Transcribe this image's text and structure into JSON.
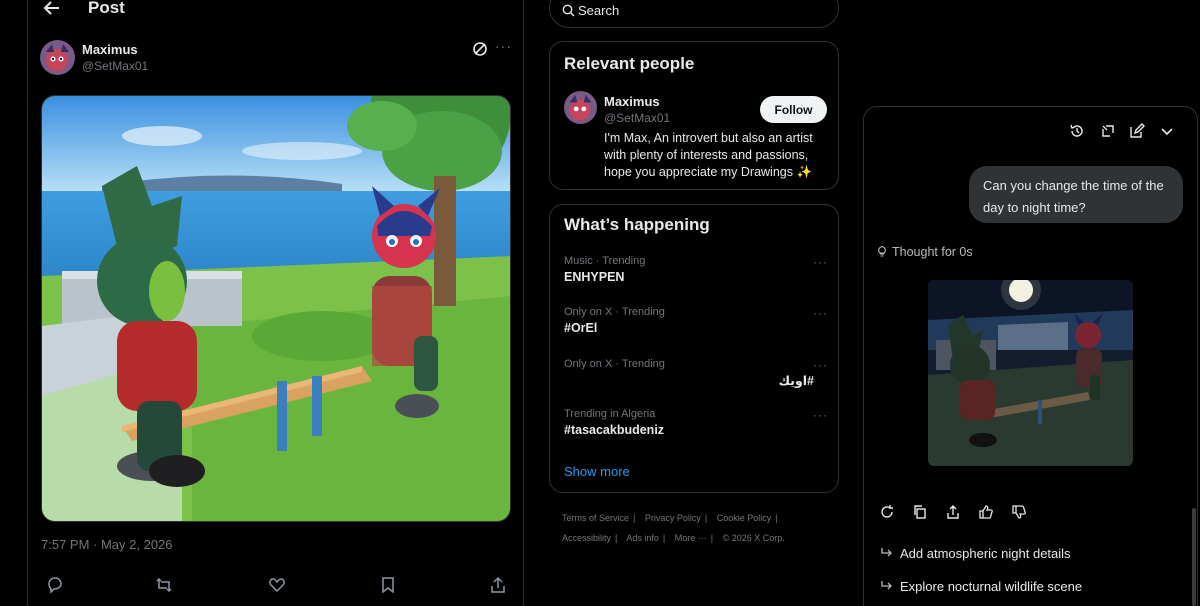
{
  "post": {
    "header_title": "Post",
    "author_name": "Maximus",
    "author_handle": "@SetMax01",
    "timestamp": "7:57 PM · May 2, 2026"
  },
  "search": {
    "placeholder": "Search"
  },
  "relevant_people": {
    "title": "Relevant people",
    "name": "Maximus",
    "handle": "@SetMax01",
    "follow_label": "Follow",
    "bio": "I'm Max, An introvert but also an artist with plenty of interests and passions, hope you appreciate my Drawings ✨"
  },
  "trending": {
    "title": "What’s happening",
    "items": [
      {
        "meta": "Music · Trending",
        "name": "ENHYPEN"
      },
      {
        "meta": "Only on X · Trending",
        "name": "#OrEl"
      },
      {
        "meta": "Only on X · Trending",
        "name": "#اويك"
      },
      {
        "meta": "Trending in Algeria",
        "name": "#tasacakbudeniz"
      }
    ],
    "show_more": "Show more"
  },
  "footer": {
    "links": [
      "Terms of Service",
      "Privacy Policy",
      "Cookie Policy",
      "Accessibility",
      "Ads info",
      "More ···",
      "© 2026 X Corp."
    ]
  },
  "grok": {
    "user_message": "Can you change the time of the day to night time?",
    "thought": "Thought for 0s",
    "suggestions": [
      "Add atmospheric night details",
      "Explore nocturnal wildlife scene"
    ]
  },
  "colors": {
    "accent": "#1d9bf0",
    "background": "#000000",
    "border": "#2f3336",
    "muted_text": "#71767b"
  }
}
